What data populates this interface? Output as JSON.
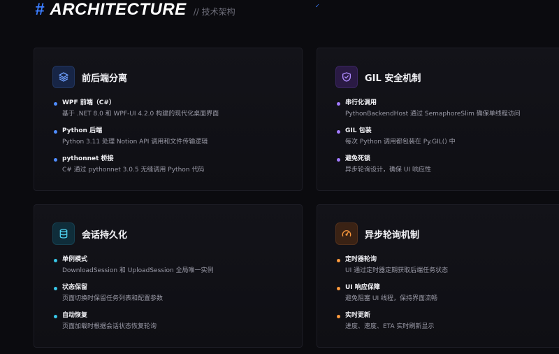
{
  "header": {
    "hash": "#",
    "title": "ARCHITECTURE",
    "subtitle": "// 技术架构"
  },
  "colors": {
    "accent": "#3b7dff",
    "blue": "#4f8dff",
    "purple": "#a27bff",
    "cyan": "#38c7e8",
    "orange": "#ff9a3d"
  },
  "cards": [
    {
      "title": "前后端分离",
      "icon": "layers-icon",
      "items": [
        {
          "title": "WPF 前端（C#）",
          "desc": "基于 .NET 8.0 和 WPF-UI 4.2.0 构建的现代化桌面界面"
        },
        {
          "title": "Python 后端",
          "desc": "Python 3.11 处理 Notion API 调用和文件传输逻辑"
        },
        {
          "title": "pythonnet 桥接",
          "desc": "C# 通过 pythonnet 3.0.5 无缝调用 Python 代码"
        }
      ]
    },
    {
      "title": "GIL 安全机制",
      "icon": "shield-icon",
      "items": [
        {
          "title": "串行化调用",
          "desc": "PythonBackendHost 通过 SemaphoreSlim 确保单线程访问"
        },
        {
          "title": "GIL 包装",
          "desc": "每次 Python 调用都包装在 Py.GIL() 中"
        },
        {
          "title": "避免死锁",
          "desc": "异步轮询设计，确保 UI 响应性"
        }
      ]
    },
    {
      "title": "会话持久化",
      "icon": "database-icon",
      "items": [
        {
          "title": "单例模式",
          "desc": "DownloadSession 和 UploadSession 全局唯一实例"
        },
        {
          "title": "状态保留",
          "desc": "页面切换时保留任务列表和配置参数"
        },
        {
          "title": "自动恢复",
          "desc": "页面加载时根据会话状态恢复轮询"
        }
      ]
    },
    {
      "title": "异步轮询机制",
      "icon": "gauge-icon",
      "items": [
        {
          "title": "定时器轮询",
          "desc": "UI 通过定时器定期获取后端任务状态"
        },
        {
          "title": "UI 响应保障",
          "desc": "避免阻塞 UI 线程，保持界面流畅"
        },
        {
          "title": "实时更新",
          "desc": "进度、速度、ETA 实时刷新显示"
        }
      ]
    }
  ]
}
